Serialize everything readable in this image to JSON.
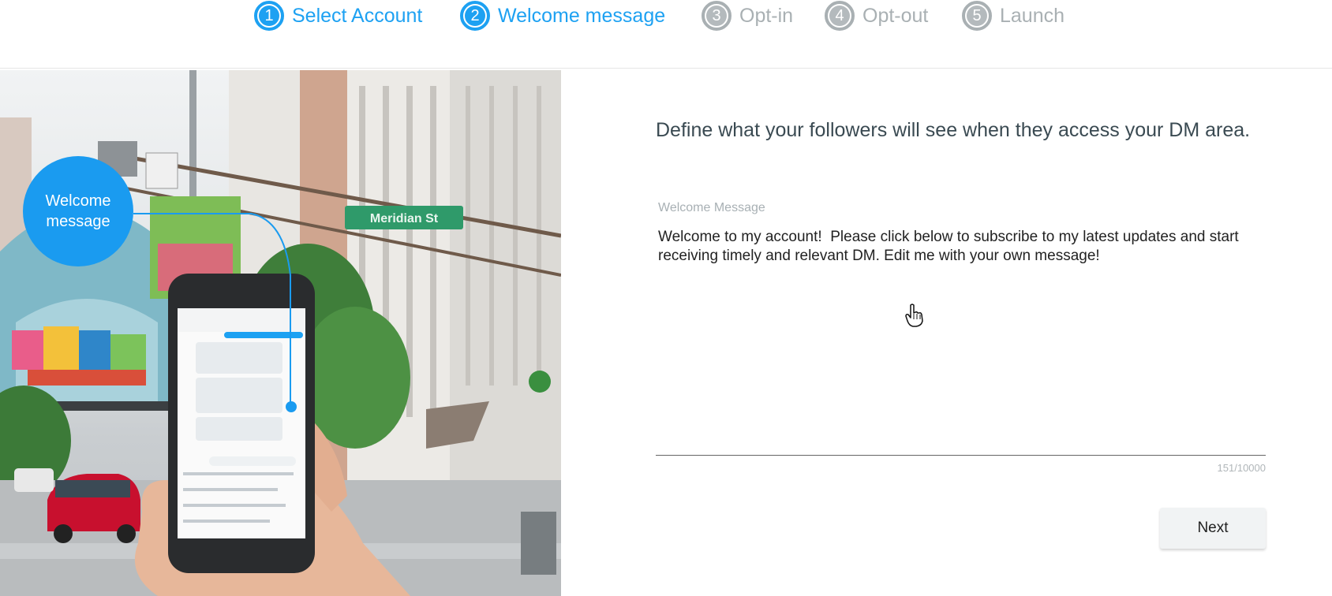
{
  "stepper": {
    "steps": [
      {
        "number": "1",
        "label": "Select Account",
        "state": "active"
      },
      {
        "number": "2",
        "label": "Welcome message",
        "state": "active"
      },
      {
        "number": "3",
        "label": "Opt-in",
        "state": "inactive"
      },
      {
        "number": "4",
        "label": "Opt-out",
        "state": "inactive"
      },
      {
        "number": "5",
        "label": "Launch",
        "state": "inactive"
      }
    ]
  },
  "illustration": {
    "bubble_line1": "Welcome",
    "bubble_line2": "message",
    "street_sign": "Meridian St"
  },
  "form": {
    "heading": "Define what your followers will see when they access your DM area.",
    "field_label": "Welcome Message",
    "message_value": "Welcome to my account!  Please click below to subscribe to my latest updates and start receiving timely and relevant DM. Edit me with your own message!",
    "char_counter": "151/10000",
    "next_label": "Next"
  },
  "colors": {
    "accent": "#1da1f2",
    "inactive": "#a9b0b3",
    "heading_text": "#3a4a52"
  }
}
